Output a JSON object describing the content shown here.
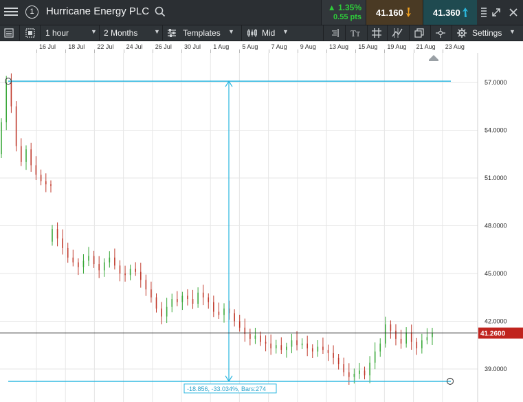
{
  "header": {
    "menu_icon": "hamburger-menu-icon",
    "workspace_number": "1",
    "instrument": "Hurricane Energy PLC",
    "search_icon": "search-icon",
    "change_percent": "1.35%",
    "change_points": "0.55 pts",
    "sell_price": "41.160",
    "buy_price": "41.360",
    "colors": {
      "up": "#2ecc3a",
      "sell_arrow": "#f0a020",
      "buy_arrow": "#2bb5d9"
    }
  },
  "toolbar": {
    "interval": "1 hour",
    "range": "2 Months",
    "templates": "Templates",
    "price_type": "Mid",
    "settings": "Settings"
  },
  "date_axis": [
    "16 Jul",
    "18 Jul",
    "22 Jul",
    "24 Jul",
    "26 Jul",
    "30 Jul",
    "1 Aug",
    "5 Aug",
    "7 Aug",
    "9 Aug",
    "13 Aug",
    "15 Aug",
    "19 Aug",
    "21 Aug",
    "23 Aug"
  ],
  "price_axis": [
    "57.0000",
    "54.0000",
    "51.0000",
    "48.0000",
    "45.0000",
    "42.0000",
    "39.0000"
  ],
  "current_price_tag": "41.2600",
  "measurement": {
    "label": "-18.856, -33.034%, Bars:274",
    "start_price": 57.08,
    "end_price": 38.23
  },
  "chart_data": {
    "type": "candlestick",
    "ylim": [
      37.5,
      57.8
    ],
    "current_price": 41.26,
    "up_color": "#3aa83a",
    "down_color": "#c0392b",
    "segments": [
      {
        "from": 52.5,
        "points": [
          54.5,
          57.0,
          55.5,
          53.0,
          52.0,
          52.8,
          51.8,
          51.2,
          50.8,
          50.6,
          50.5
        ]
      },
      {
        "from": 47.0,
        "points": [
          47.8,
          47.2,
          46.6,
          46.0,
          45.7,
          45.4,
          45.8,
          46.1,
          45.6,
          45.2,
          45.7,
          46.0,
          45.5,
          45.0,
          44.9,
          45.3,
          45.1,
          44.6,
          44.0,
          43.5,
          42.8,
          42.3,
          42.9,
          43.4,
          43.2,
          43.6,
          43.4,
          43.1,
          43.8,
          43.5,
          43.2,
          42.6,
          42.4,
          42.8,
          42.5,
          42.0,
          41.6,
          41.2,
          40.9,
          41.1,
          40.7,
          40.6,
          40.3,
          40.5,
          40.2,
          40.4,
          40.8,
          40.5,
          40.6,
          40.3,
          40.1,
          40.4,
          40.2,
          40.0,
          39.7,
          39.3,
          38.8,
          38.5,
          38.7,
          38.9,
          38.6,
          39.4,
          40.1,
          40.6,
          41.8,
          41.4,
          40.9,
          40.6,
          41.3,
          40.7,
          40.3,
          40.8,
          41.0,
          41.26
        ]
      }
    ]
  }
}
